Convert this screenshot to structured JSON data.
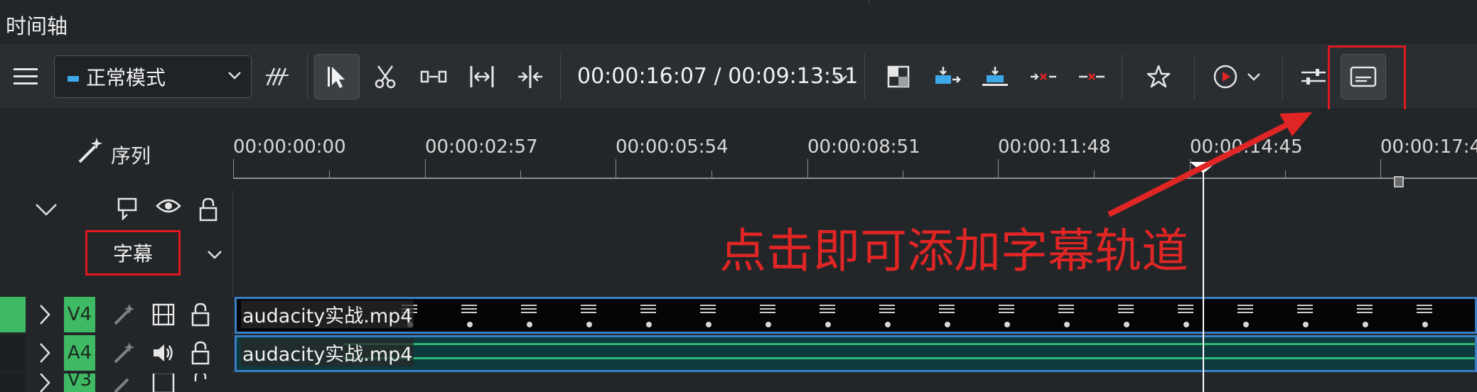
{
  "window": {
    "title": "时间轴"
  },
  "toolbar": {
    "menu_icon": "hamburger-icon",
    "mode_select": {
      "value": "正常模式"
    },
    "timecode": "00:00:16:07 / 00:09:13:51",
    "buttons": [
      {
        "name": "spacer-tool",
        "icon": "spacer-icon"
      },
      {
        "name": "select-tool",
        "icon": "cursor-arrow-icon",
        "active": true
      },
      {
        "name": "razor-tool",
        "icon": "scissors-icon"
      },
      {
        "name": "slip-tool",
        "icon": "slip-icon"
      },
      {
        "name": "ripple-tool",
        "icon": "ripple-icon"
      },
      {
        "name": "multicam-tool",
        "icon": "multicam-icon"
      },
      {
        "name": "composite-toggle",
        "icon": "composite-icon"
      },
      {
        "name": "insert-clip",
        "icon": "insert-icon"
      },
      {
        "name": "overwrite-clip",
        "icon": "overwrite-icon"
      },
      {
        "name": "lift",
        "icon": "lift-icon"
      },
      {
        "name": "extract",
        "icon": "extract-icon"
      },
      {
        "name": "favorite",
        "icon": "star-icon"
      },
      {
        "name": "preview-render",
        "icon": "render-icon"
      },
      {
        "name": "timeline-settings",
        "icon": "sliders-icon"
      },
      {
        "name": "subtitle-track-toggle",
        "icon": "subtitle-icon",
        "active": true
      }
    ]
  },
  "header": {
    "sequence_label": "序列"
  },
  "ruler": {
    "ticks": [
      "00:00:00:00",
      "00:00:02:57",
      "00:00:05:54",
      "00:00:08:51",
      "00:00:11:48",
      "00:00:14:45",
      "00:00:17:4"
    ]
  },
  "subtitle_track": {
    "label": "字幕"
  },
  "tracks": [
    {
      "tag": "V4",
      "type": "video",
      "clip_name": "audacity实战.mp4"
    },
    {
      "tag": "A4",
      "type": "audio",
      "clip_name": "audacity实战.mp4"
    },
    {
      "tag": "V3",
      "type": "video",
      "clip_name": ""
    }
  ],
  "annotation": {
    "text": "点击即可添加字幕轨道",
    "color": "#e02525"
  },
  "colors": {
    "accent_track": "#3fb964",
    "clip_border": "#3a7fc4",
    "highlight": "#e0191f"
  }
}
